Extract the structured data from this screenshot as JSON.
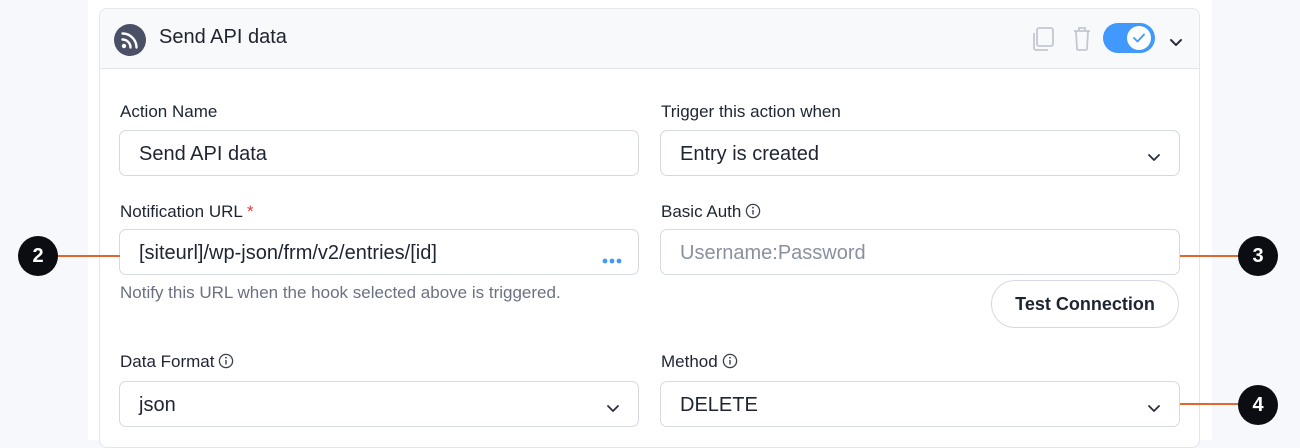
{
  "header": {
    "title": "Send API data",
    "toggle_on": true,
    "icons": [
      "rss-icon",
      "duplicate-icon",
      "trash-icon",
      "check-icon",
      "chevron-down-icon"
    ]
  },
  "form": {
    "action_name": {
      "label": "Action Name",
      "value": "Send API data"
    },
    "trigger": {
      "label": "Trigger this action when",
      "value": "Entry is created"
    },
    "notification_url": {
      "label": "Notification URL",
      "required_mark": "*",
      "value": "[siteurl]/wp-json/frm/v2/entries/[id]",
      "help": "Notify this URL when the hook selected above is triggered."
    },
    "basic_auth": {
      "label": "Basic Auth",
      "placeholder": "Username:Password"
    },
    "test_connection_label": "Test Connection",
    "data_format": {
      "label": "Data Format",
      "value": "json"
    },
    "method": {
      "label": "Method",
      "value": "DELETE"
    }
  },
  "callouts": [
    "2",
    "3",
    "4"
  ],
  "colors": {
    "accent": "#4199fd",
    "callout_line": "#e0682f",
    "required": "#e0393e"
  }
}
